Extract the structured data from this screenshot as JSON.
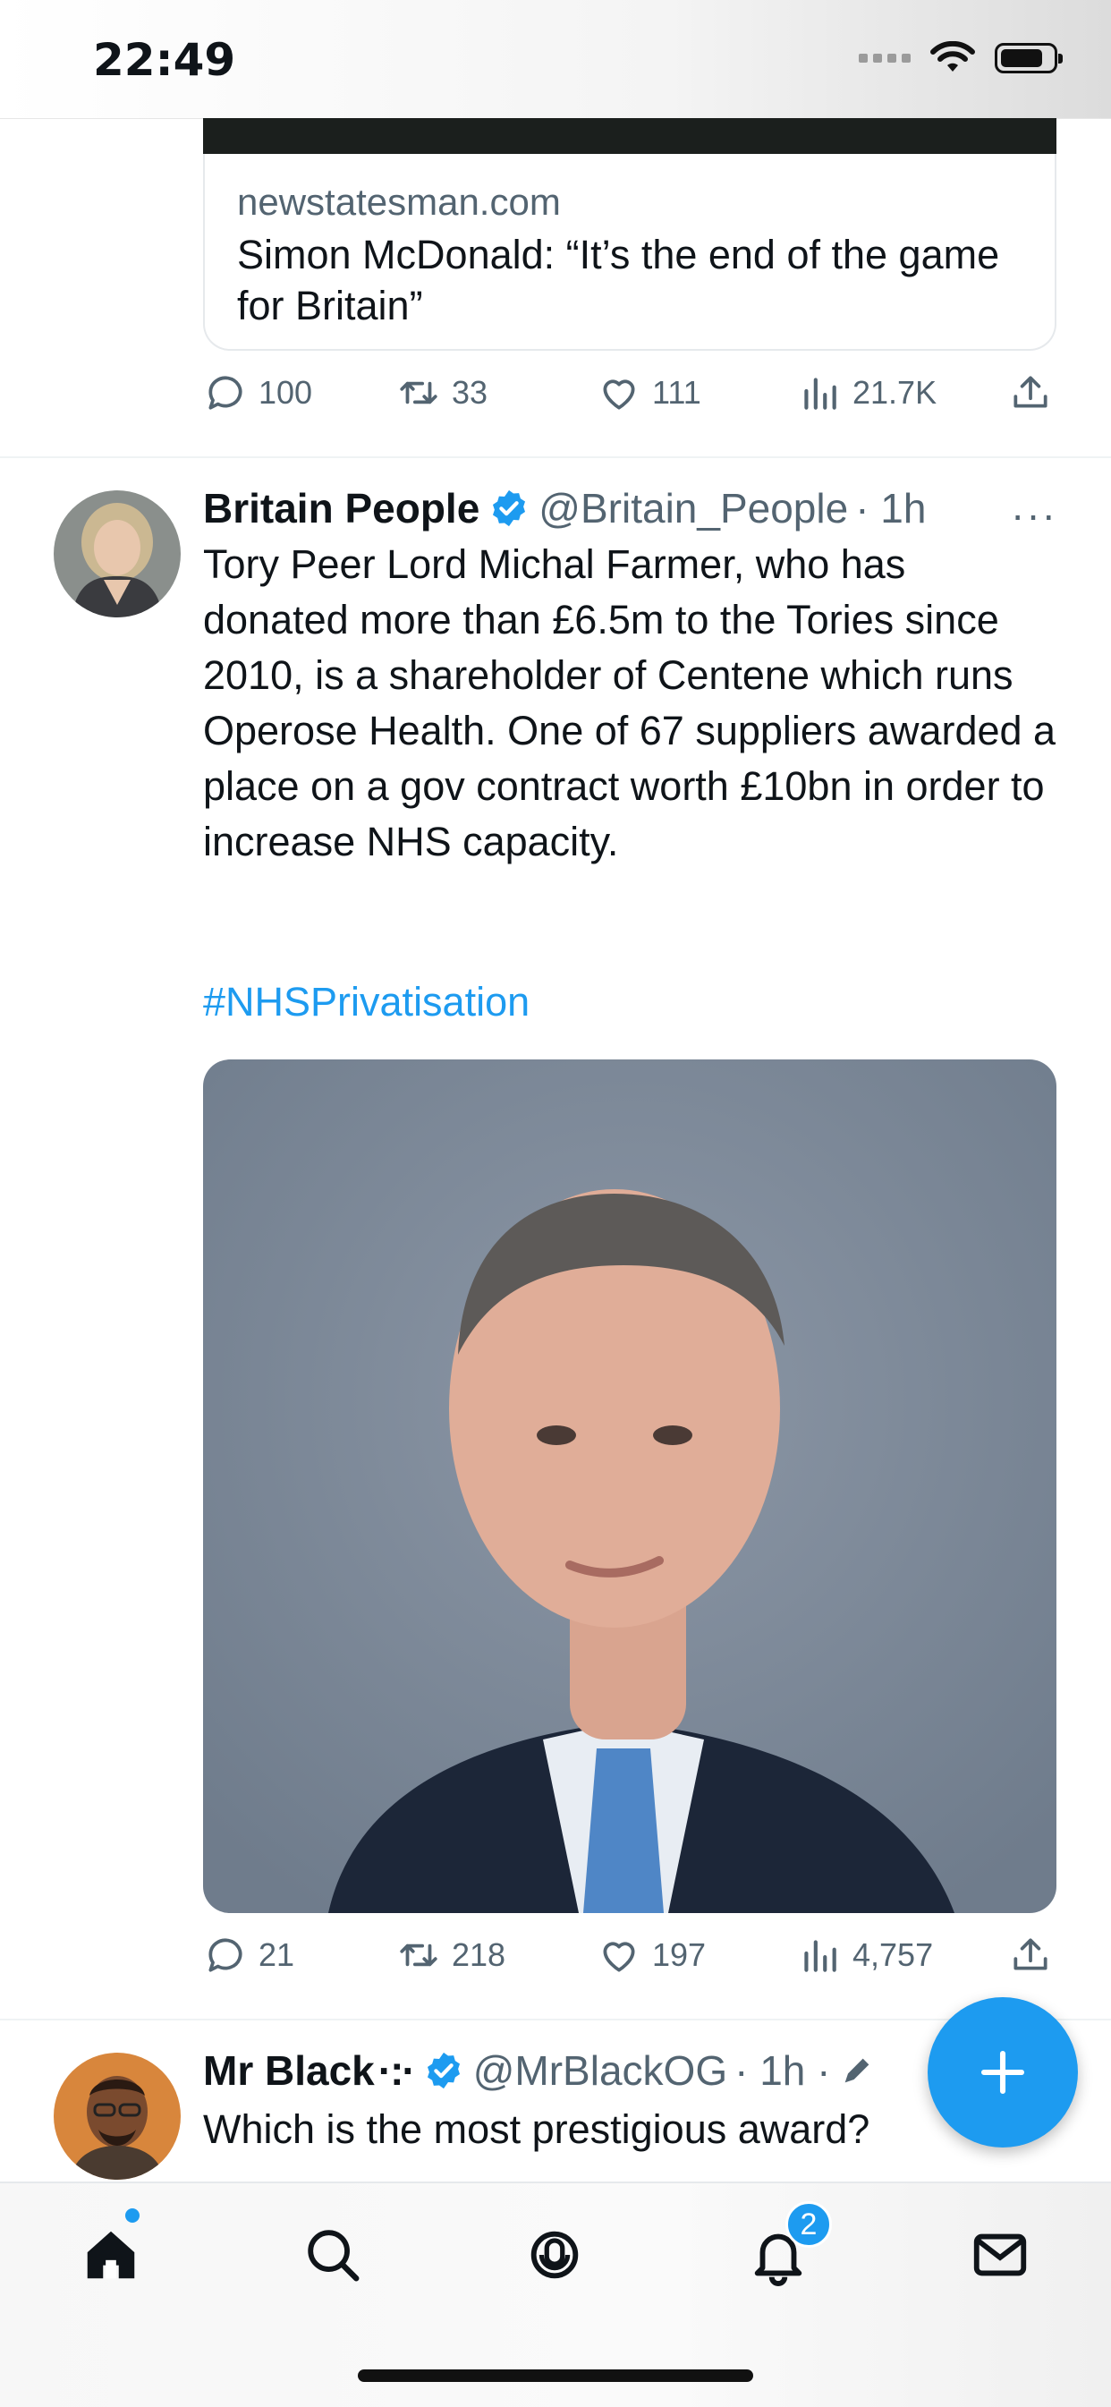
{
  "status_bar": {
    "time": "22:49"
  },
  "previous_tweet": {
    "card_domain": "newstatesman.com",
    "card_title": "Simon McDonald: “It’s the end of the game for Britain”",
    "replies": "100",
    "retweets": "33",
    "likes": "111",
    "views": "21.7K"
  },
  "tweet": {
    "name": "Britain People",
    "handle": "@Britain_People",
    "time": "· 1h",
    "more": "···",
    "text": "Tory Peer Lord Michal Farmer, who has donated more than £6.5m to the Tories since 2010, is a shareholder of Centene which runs Operose Health. One of 67 suppliers awarded a place on a gov contract worth £10bn in order to increase NHS capacity.",
    "hashtag": "#NHSPrivatisation",
    "replies": "21",
    "retweets": "218",
    "likes": "197",
    "views": "4,757"
  },
  "next_tweet": {
    "name": "Mr Black",
    "handle": "@MrBlackOG",
    "time": "· 1h ·",
    "text": "Which is the most prestigious award?"
  },
  "tab_bar": {
    "notifications_badge": "2"
  },
  "colors": {
    "accent": "#1d9bf0",
    "muted": "#536471",
    "text": "#0f1419"
  },
  "icons": [
    "reply-icon",
    "retweet-icon",
    "like-icon",
    "views-icon",
    "share-icon",
    "verified-icon",
    "home-icon",
    "search-icon",
    "spaces-icon",
    "notifications-icon",
    "messages-icon",
    "compose-icon"
  ]
}
